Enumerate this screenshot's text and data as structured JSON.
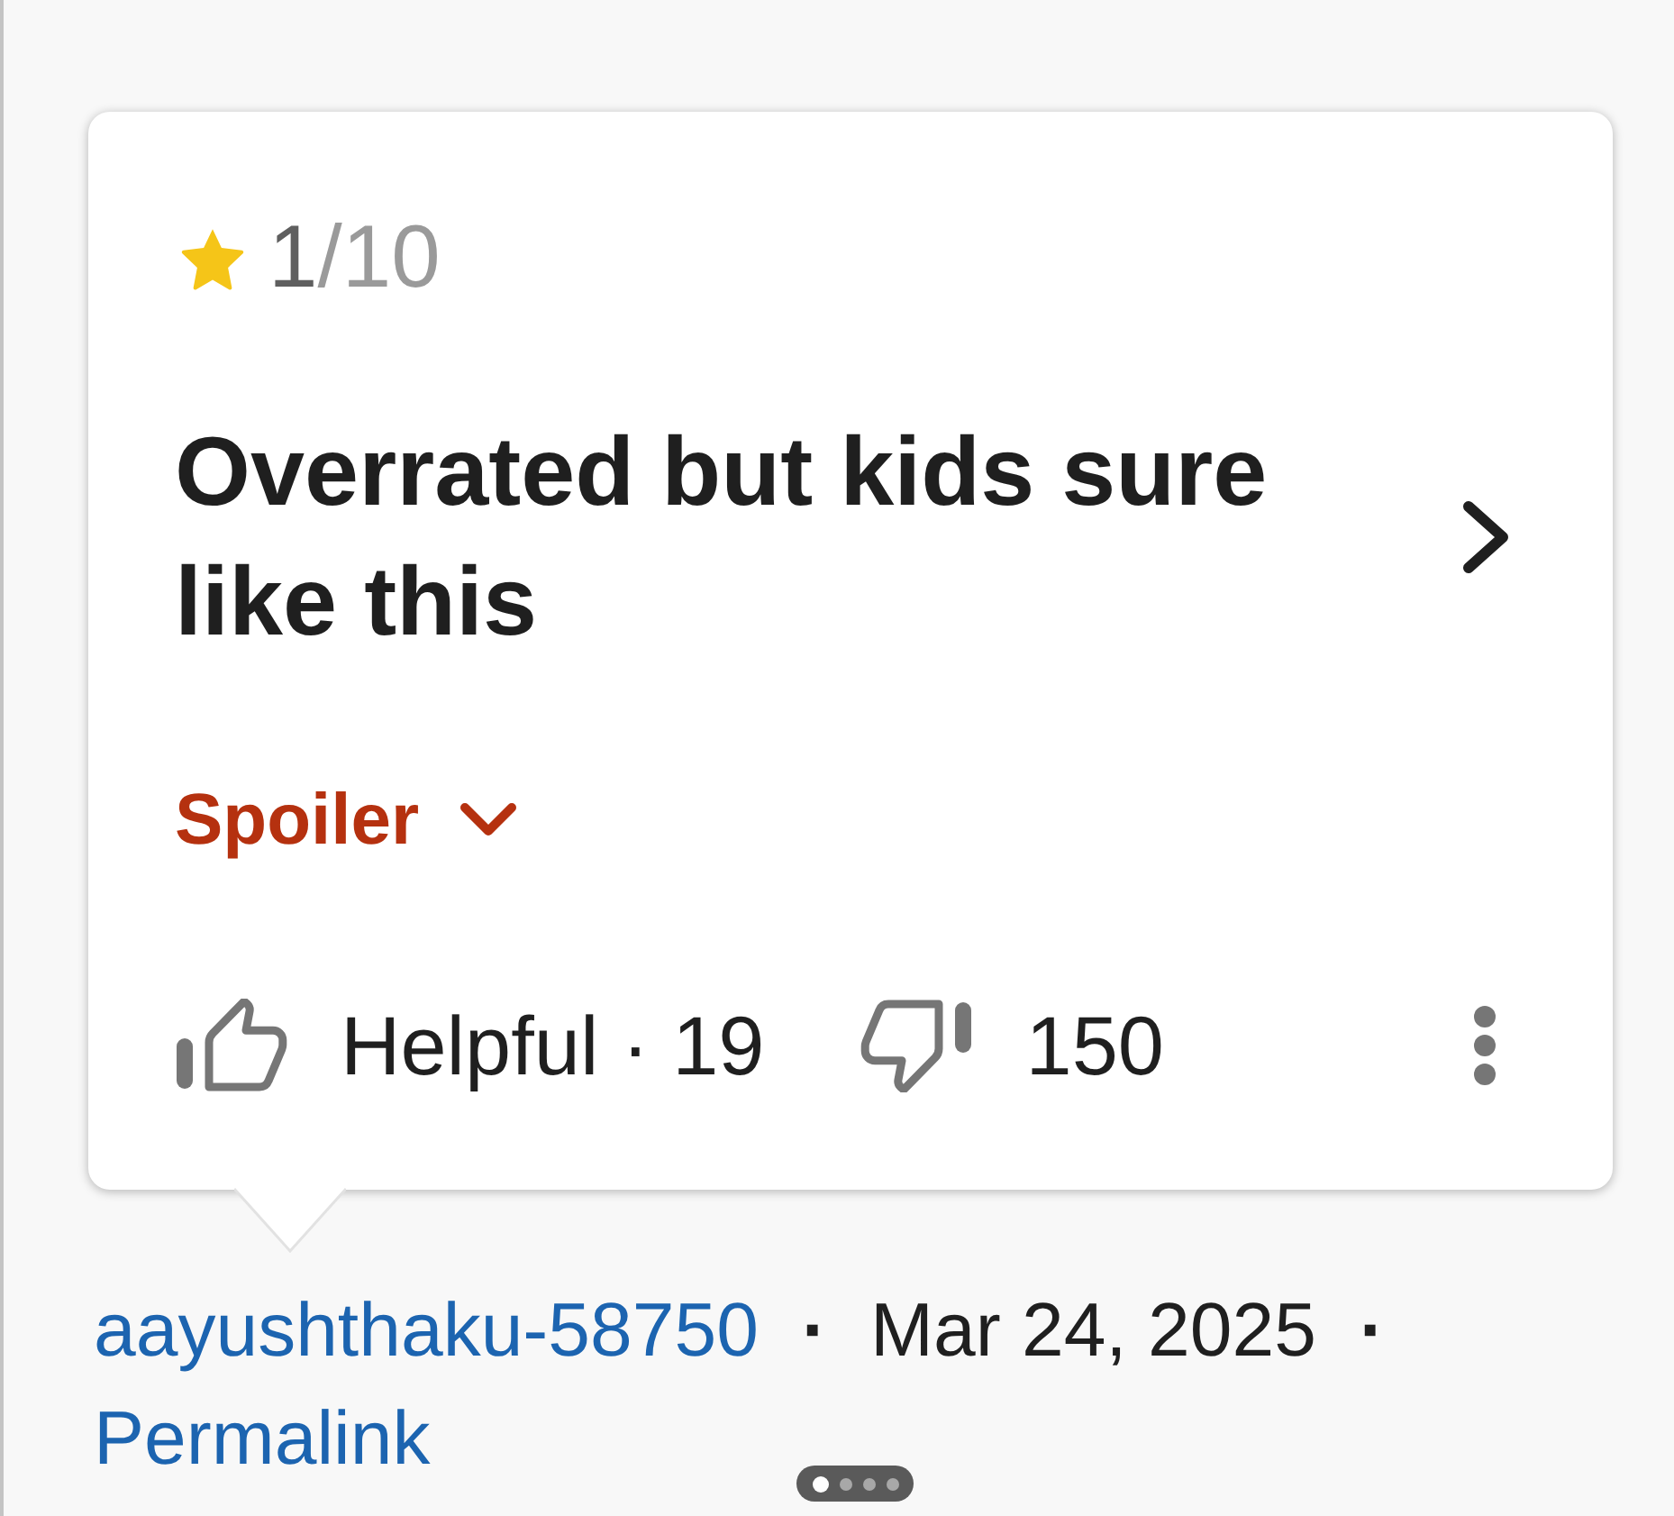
{
  "review": {
    "rating": {
      "value": "1",
      "scale": "/10"
    },
    "title": "Overrated but kids sure like this",
    "spoiler": {
      "label": "Spoiler",
      "expanded": false
    },
    "helpful": {
      "label": "Helpful",
      "separator": "·",
      "count": "19"
    },
    "not_helpful": {
      "count": "150"
    }
  },
  "footer": {
    "author": "aayushthaku-58750",
    "separator_1": "·",
    "date": "Mar 24, 2025",
    "separator_2": "·",
    "permalink": "Permalink"
  },
  "page_indicator": {
    "dots": [
      {
        "selected": true
      },
      {
        "selected": false
      },
      {
        "selected": false
      },
      {
        "selected": false
      }
    ]
  }
}
